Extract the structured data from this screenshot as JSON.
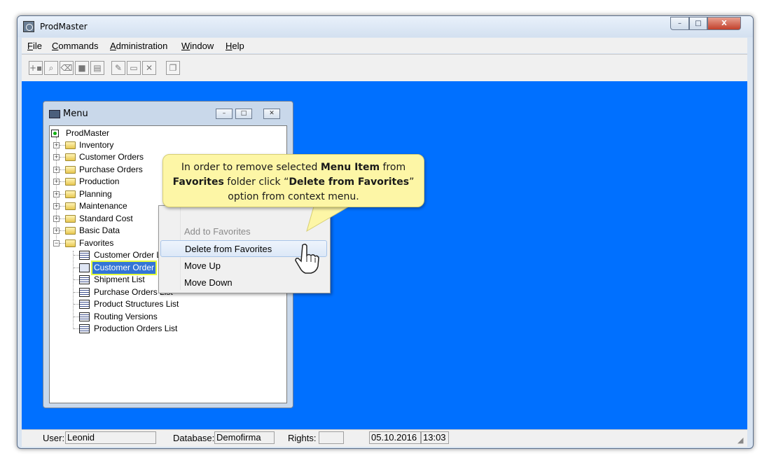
{
  "window": {
    "title": "ProdMaster",
    "minimize": "–",
    "maximize": "□",
    "close": "X"
  },
  "menubar": [
    {
      "label": "File",
      "key": "F",
      "rest": "ile"
    },
    {
      "label": "Commands",
      "key": "C",
      "rest": "ommands"
    },
    {
      "label": "Administration",
      "key": "A",
      "rest": "dministration"
    },
    {
      "label": "Window",
      "key": "W",
      "rest": "indow"
    },
    {
      "label": "Help",
      "key": "H",
      "rest": "elp"
    }
  ],
  "toolbar": [
    {
      "icon": "add-record-icon",
      "glyph": "+▪"
    },
    {
      "icon": "binoculars-icon",
      "glyph": "⌕"
    },
    {
      "icon": "eraser-icon",
      "glyph": "⌫"
    },
    {
      "icon": "stop-icon",
      "glyph": "■"
    },
    {
      "icon": "document-icon",
      "glyph": "▤"
    },
    {
      "icon": "new-folder-icon",
      "glyph": "✎"
    },
    {
      "icon": "folder-icon",
      "glyph": "▭"
    },
    {
      "icon": "delete-icon",
      "glyph": "✕"
    },
    {
      "icon": "window-icon",
      "glyph": "❐"
    }
  ],
  "menu_window": {
    "title": "Menu",
    "root": "ProdMaster",
    "folders": [
      "Inventory",
      "Customer Orders",
      "Purchase Orders",
      "Production",
      "Planning",
      "Maintenance",
      "Standard Cost",
      "Basic Data"
    ],
    "favorites_label": "Favorites",
    "favorites": [
      "Customer Order List",
      "Customer Order",
      "Shipment List",
      "Purchase Orders List",
      "Product Structures List",
      "Routing Versions",
      "Production Orders List"
    ],
    "selected_favorite": "Customer Order"
  },
  "context_menu": [
    {
      "label": "Add to Favorites",
      "enabled": false
    },
    {
      "label": "Delete from Favorites",
      "enabled": true,
      "hover": true
    },
    {
      "label": "Move Up",
      "enabled": true
    },
    {
      "label": "Move Down",
      "enabled": true
    }
  ],
  "callout": {
    "t1": "In order to remove selected ",
    "b1": "Menu Item",
    "t2": " from",
    "b2": "Favorites",
    "t3": " folder click “",
    "b3": "Delete from Favorites",
    "t4": "”",
    "t5": "option from context menu."
  },
  "statusbar": {
    "user_label": "User:",
    "user": "Leonid",
    "db_label": "Database:",
    "db": "Demofirma",
    "rights_label": "Rights:",
    "rights": "",
    "date": "05.10.2016",
    "time": "13:03"
  },
  "colors": {
    "desktop": "#0070ff",
    "callout": "#fdf6a6",
    "selection": "#3375d6",
    "highlight": "#e6ff3a"
  }
}
